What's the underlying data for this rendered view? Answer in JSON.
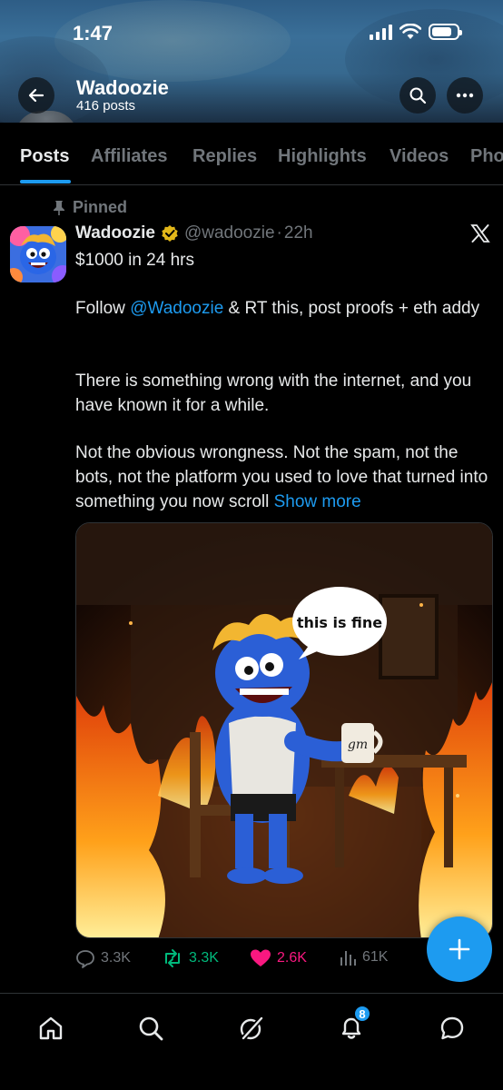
{
  "status_bar": {
    "time": "1:47"
  },
  "profile": {
    "name": "Wadoozie",
    "post_count": "416 posts"
  },
  "tabs": [
    {
      "label": "Posts",
      "active": true
    },
    {
      "label": "Affiliates",
      "active": false
    },
    {
      "label": "Replies",
      "active": false
    },
    {
      "label": "Highlights",
      "active": false
    },
    {
      "label": "Videos",
      "active": false
    },
    {
      "label": "Pho",
      "active": false
    }
  ],
  "post": {
    "pinned_label": "Pinned",
    "author_name": "Wadoozie",
    "handle": "@wadoozie",
    "separator": "·",
    "time": "22h",
    "line1": "$1000 in 24 hrs",
    "line2_prefix": "Follow ",
    "line2_mention": "@Wadoozie",
    "line2_suffix": " & RT this, post proofs + eth addy",
    "paragraph2": "There is something wrong with the internet, and you have known it for a while.",
    "paragraph3": "Not the obvious wrongness. Not the spam, not the bots, not the platform you used to love that turned into something you now scroll",
    "show_more": "Show more",
    "image": {
      "speech_bubble": "this is fine",
      "mug_text": "gm"
    },
    "actions": {
      "replies": "3.3K",
      "reposts": "3.3K",
      "likes": "2.6K",
      "views": "61K"
    }
  },
  "bottom_nav": {
    "notifications_badge": "8"
  },
  "colors": {
    "accent": "#1d9bf0",
    "repost": "#00ba7c",
    "like": "#f91880",
    "muted": "#71767b",
    "verified": "#e2b719"
  }
}
